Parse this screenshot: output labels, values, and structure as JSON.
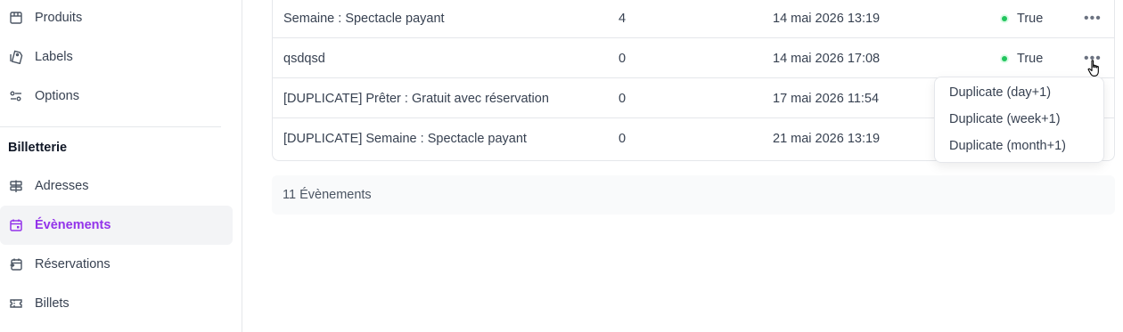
{
  "sidebar": {
    "items_top": [
      {
        "label": "Produits",
        "icon": "box-icon"
      },
      {
        "label": "Labels",
        "icon": "tag-icon"
      },
      {
        "label": "Options",
        "icon": "options-icon"
      }
    ],
    "section_title": "Billetterie",
    "items_billetterie": [
      {
        "label": "Adresses",
        "icon": "signpost-icon"
      },
      {
        "label": "Évènements",
        "icon": "calendar-icon",
        "active": true
      },
      {
        "label": "Réservations",
        "icon": "reservation-icon"
      },
      {
        "label": "Billets",
        "icon": "ticket-icon"
      }
    ],
    "active_color": "#9333ea"
  },
  "table": {
    "rows": [
      {
        "name": "Semaine : Spectacle payant",
        "count": "4",
        "date": "14 mai 2026 13:19",
        "status": "True"
      },
      {
        "name": "qsdqsd",
        "count": "0",
        "date": "14 mai 2026 17:08",
        "status": "True"
      },
      {
        "name": "[DUPLICATE] Prêter : Gratuit avec réservation",
        "count": "0",
        "date": "17 mai 2026 11:54",
        "status": ""
      },
      {
        "name": "[DUPLICATE] Semaine : Spectacle payant",
        "count": "0",
        "date": "21 mai 2026 13:19",
        "status": ""
      }
    ],
    "status_color": "#22c55e"
  },
  "footer": {
    "count_label": "11 Évènements"
  },
  "dropdown": {
    "items": [
      "Duplicate (day+1)",
      "Duplicate (week+1)",
      "Duplicate (month+1)"
    ]
  }
}
